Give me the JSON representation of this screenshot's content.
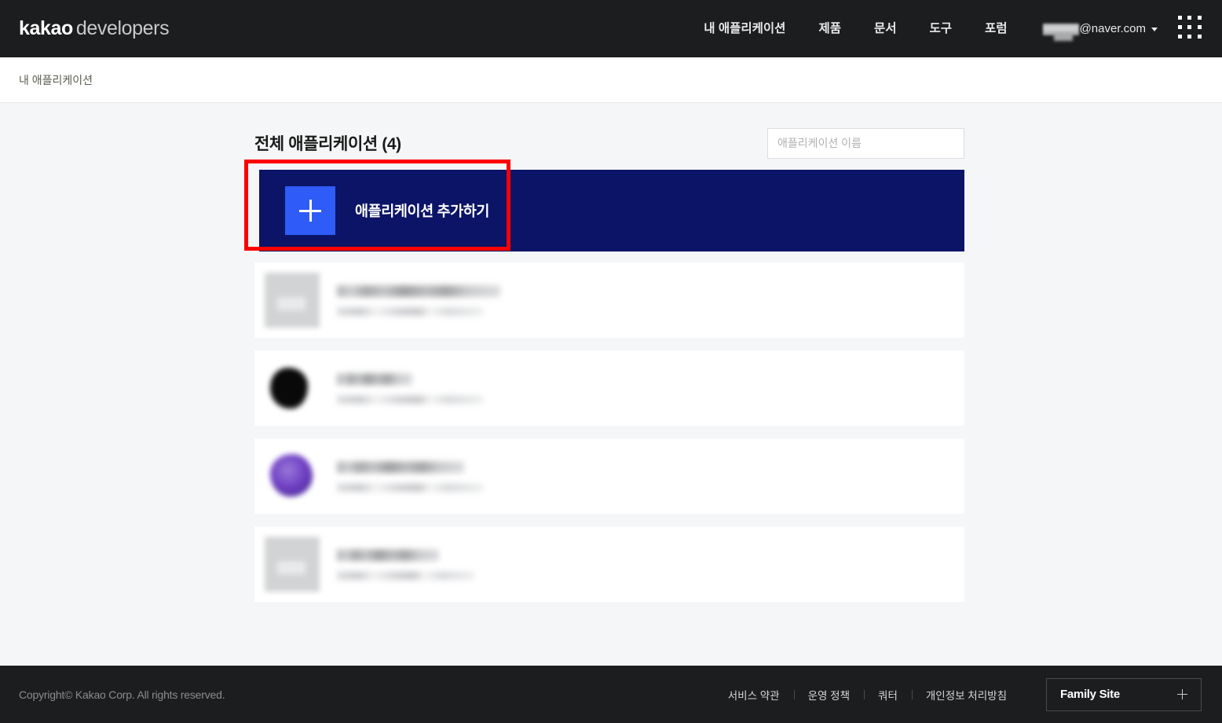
{
  "header": {
    "logo_kakao": "kakao",
    "logo_developers": "developers",
    "nav": [
      {
        "label": "내 애플리케이션",
        "name": "nav-my-applications"
      },
      {
        "label": "제품",
        "name": "nav-products"
      },
      {
        "label": "문서",
        "name": "nav-docs"
      },
      {
        "label": "도구",
        "name": "nav-tools"
      },
      {
        "label": "포럼",
        "name": "nav-forum"
      }
    ],
    "account_email": "@naver.com",
    "apps_grid_icon": "grid-3x3-icon",
    "caret_icon": "chevron-down-icon"
  },
  "breadcrumb": {
    "current": "내 애플리케이션"
  },
  "main": {
    "list_title": "전체 애플리케이션 (4)",
    "search_placeholder": "애플리케이션 이름",
    "search_value": "",
    "add_app_label": "애플리케이션 추가하기",
    "add_app_icon": "plus-icon",
    "highlight_color": "#ff0000",
    "banner_color": "#0b1466",
    "accent_color": "#2f5bf6",
    "apps": [
      {
        "name_redacted": true,
        "thumb": "gray-placeholder-thumbnail",
        "name_width": 208,
        "meta_width": 186
      },
      {
        "name_redacted": true,
        "thumb": "black-blob-thumbnail",
        "name_width": 96,
        "meta_width": 186
      },
      {
        "name_redacted": true,
        "thumb": "purple-blob-thumbnail",
        "name_width": 162,
        "meta_width": 186
      },
      {
        "name_redacted": true,
        "thumb": "gray-placeholder-thumbnail",
        "name_width": 130,
        "meta_width": 175
      }
    ]
  },
  "footer": {
    "copyright": "Copyright© Kakao Corp. All rights reserved.",
    "links": [
      {
        "label": "서비스 약관",
        "name": "footer-terms"
      },
      {
        "label": "운영 정책",
        "name": "footer-policy"
      },
      {
        "label": "쿼터",
        "name": "footer-quota"
      },
      {
        "label": "개인정보 처리방침",
        "name": "footer-privacy"
      }
    ],
    "family_site_label": "Family Site",
    "family_site_icon": "plus-icon"
  }
}
